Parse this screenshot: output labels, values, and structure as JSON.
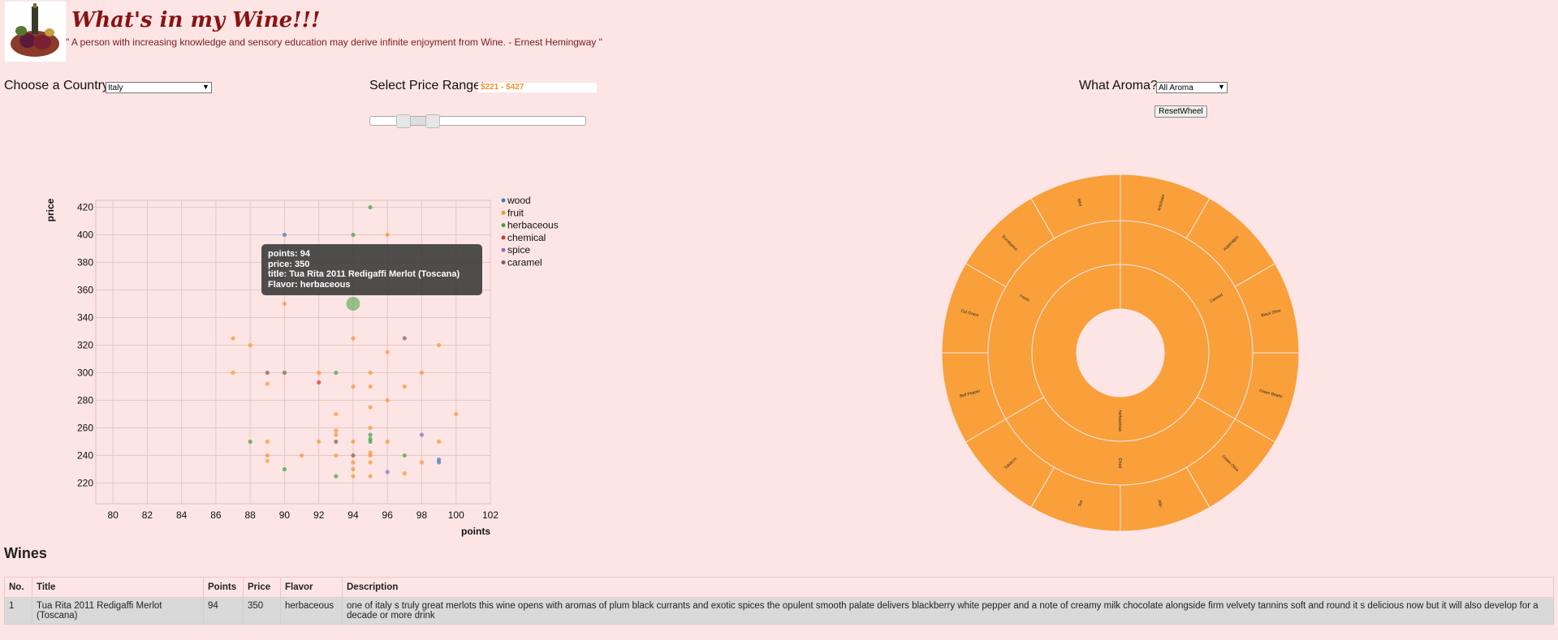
{
  "header": {
    "title": "What's in my Wine!!!",
    "quote": "\" A person with increasing knowledge and sensory education may derive infinite enjoyment from Wine. - Ernest Hemingway \""
  },
  "controls": {
    "country_label": "Choose a Country:",
    "country_value": "Italy",
    "price_label": "Select Price Range:",
    "price_value": "$221 - $427",
    "price_range": [
      221,
      427
    ],
    "aroma_label": "What Aroma?:",
    "aroma_value": "All Aroma",
    "reset_label": "ResetWheel"
  },
  "tooltip": {
    "points": "points: 94",
    "price": "price: 350",
    "title": "title: Tua Rita 2011 Redigaffi Merlot (Toscana)",
    "flavor": "Flavor: herbaceous"
  },
  "chart_data": {
    "type": "scatter",
    "xlabel": "points",
    "ylabel": "price",
    "xlim": [
      79,
      102
    ],
    "ylim": [
      205,
      425
    ],
    "xticks": [
      "80",
      "82",
      "84",
      "86",
      "88",
      "90",
      "92",
      "94",
      "96",
      "98",
      "100",
      "102"
    ],
    "yticks": [
      "220",
      "240",
      "260",
      "280",
      "300",
      "320",
      "340",
      "360",
      "380",
      "400",
      "420"
    ],
    "grid": true,
    "legend_position": "right",
    "colors": {
      "wood": "#3a7fb8",
      "fruit": "#f7952f",
      "herbaceous": "#3ea33e",
      "chemical": "#d83030",
      "spice": "#9a67bd",
      "caramel": "#8c5a48"
    },
    "legend": [
      "wood",
      "fruit",
      "herbaceous",
      "chemical",
      "spice",
      "caramel"
    ],
    "highlight": {
      "x": 94,
      "y": 350,
      "flavor": "herbaceous"
    },
    "points": [
      {
        "x": 95,
        "y": 420,
        "flavor": "herbaceous"
      },
      {
        "x": 90,
        "y": 400,
        "flavor": "wood"
      },
      {
        "x": 94,
        "y": 400,
        "flavor": "herbaceous"
      },
      {
        "x": 96,
        "y": 400,
        "flavor": "fruit"
      },
      {
        "x": 90,
        "y": 350,
        "flavor": "fruit"
      },
      {
        "x": 87,
        "y": 325,
        "flavor": "fruit"
      },
      {
        "x": 88,
        "y": 320,
        "flavor": "fruit"
      },
      {
        "x": 94,
        "y": 325,
        "flavor": "fruit"
      },
      {
        "x": 97,
        "y": 325,
        "flavor": "caramel"
      },
      {
        "x": 99,
        "y": 320,
        "flavor": "fruit"
      },
      {
        "x": 96,
        "y": 315,
        "flavor": "fruit"
      },
      {
        "x": 87,
        "y": 300,
        "flavor": "fruit"
      },
      {
        "x": 89,
        "y": 300,
        "flavor": "caramel"
      },
      {
        "x": 90,
        "y": 300,
        "flavor": "caramel"
      },
      {
        "x": 92,
        "y": 300,
        "flavor": "fruit"
      },
      {
        "x": 93,
        "y": 300,
        "flavor": "herbaceous"
      },
      {
        "x": 95,
        "y": 300,
        "flavor": "fruit"
      },
      {
        "x": 98,
        "y": 300,
        "flavor": "fruit"
      },
      {
        "x": 89,
        "y": 292,
        "flavor": "fruit"
      },
      {
        "x": 92,
        "y": 293,
        "flavor": "chemical"
      },
      {
        "x": 94,
        "y": 290,
        "flavor": "fruit"
      },
      {
        "x": 95,
        "y": 290,
        "flavor": "fruit"
      },
      {
        "x": 97,
        "y": 290,
        "flavor": "fruit"
      },
      {
        "x": 96,
        "y": 280,
        "flavor": "fruit"
      },
      {
        "x": 95,
        "y": 275,
        "flavor": "fruit"
      },
      {
        "x": 93,
        "y": 270,
        "flavor": "fruit"
      },
      {
        "x": 100,
        "y": 270,
        "flavor": "fruit"
      },
      {
        "x": 95,
        "y": 260,
        "flavor": "fruit"
      },
      {
        "x": 93,
        "y": 258,
        "flavor": "fruit"
      },
      {
        "x": 98,
        "y": 255,
        "flavor": "spice"
      },
      {
        "x": 93,
        "y": 255,
        "flavor": "fruit"
      },
      {
        "x": 95,
        "y": 255,
        "flavor": "herbaceous"
      },
      {
        "x": 88,
        "y": 250,
        "flavor": "herbaceous"
      },
      {
        "x": 89,
        "y": 250,
        "flavor": "fruit"
      },
      {
        "x": 92,
        "y": 250,
        "flavor": "fruit"
      },
      {
        "x": 93,
        "y": 250,
        "flavor": "caramel"
      },
      {
        "x": 94,
        "y": 250,
        "flavor": "fruit"
      },
      {
        "x": 95,
        "y": 250,
        "flavor": "herbaceous"
      },
      {
        "x": 96,
        "y": 250,
        "flavor": "fruit"
      },
      {
        "x": 99,
        "y": 250,
        "flavor": "fruit"
      },
      {
        "x": 95,
        "y": 252,
        "flavor": "herbaceous"
      },
      {
        "x": 89,
        "y": 240,
        "flavor": "fruit"
      },
      {
        "x": 91,
        "y": 240,
        "flavor": "fruit"
      },
      {
        "x": 93,
        "y": 240,
        "flavor": "fruit"
      },
      {
        "x": 94,
        "y": 240,
        "flavor": "caramel"
      },
      {
        "x": 95,
        "y": 240,
        "flavor": "fruit"
      },
      {
        "x": 95,
        "y": 242,
        "flavor": "fruit"
      },
      {
        "x": 97,
        "y": 240,
        "flavor": "herbaceous"
      },
      {
        "x": 89,
        "y": 236,
        "flavor": "fruit"
      },
      {
        "x": 94,
        "y": 235,
        "flavor": "fruit"
      },
      {
        "x": 95,
        "y": 235,
        "flavor": "fruit"
      },
      {
        "x": 98,
        "y": 235,
        "flavor": "fruit"
      },
      {
        "x": 99,
        "y": 237,
        "flavor": "wood"
      },
      {
        "x": 99,
        "y": 235,
        "flavor": "wood"
      },
      {
        "x": 90,
        "y": 230,
        "flavor": "herbaceous"
      },
      {
        "x": 94,
        "y": 230,
        "flavor": "fruit"
      },
      {
        "x": 96,
        "y": 228,
        "flavor": "spice"
      },
      {
        "x": 97,
        "y": 227,
        "flavor": "fruit"
      },
      {
        "x": 93,
        "y": 225,
        "flavor": "herbaceous"
      },
      {
        "x": 94,
        "y": 225,
        "flavor": "fruit"
      },
      {
        "x": 95,
        "y": 225,
        "flavor": "fruit"
      }
    ]
  },
  "wheel": {
    "color": "#f9a03b",
    "center_label": "herbaceous",
    "middle": [
      "Canned",
      "Dried",
      "Fresh"
    ],
    "outer": [
      "Artichoke",
      "Asparagus",
      "Black Olive",
      "Green Beans",
      "Green Olive",
      "Jalp.",
      "Tea",
      "Tobacco",
      "Bell Pepper",
      "Cut Grass",
      "Eucalyptus",
      "Mint"
    ]
  },
  "table": {
    "title": "Wines",
    "headers": [
      "No.",
      "Title",
      "Points",
      "Price",
      "Flavor",
      "Description"
    ],
    "rows": [
      [
        "1",
        "Tua Rita 2011 Redigaffi Merlot (Toscana)",
        "94",
        "350",
        "herbaceous",
        "one of italy s truly great merlots this wine opens with aromas of plum black currants and exotic spices the opulent smooth palate delivers blackberry white pepper and a note of creamy milk chocolate alongside firm velvety tannins soft and round it s delicious now but it will also develop for a decade or more drink"
      ]
    ]
  }
}
